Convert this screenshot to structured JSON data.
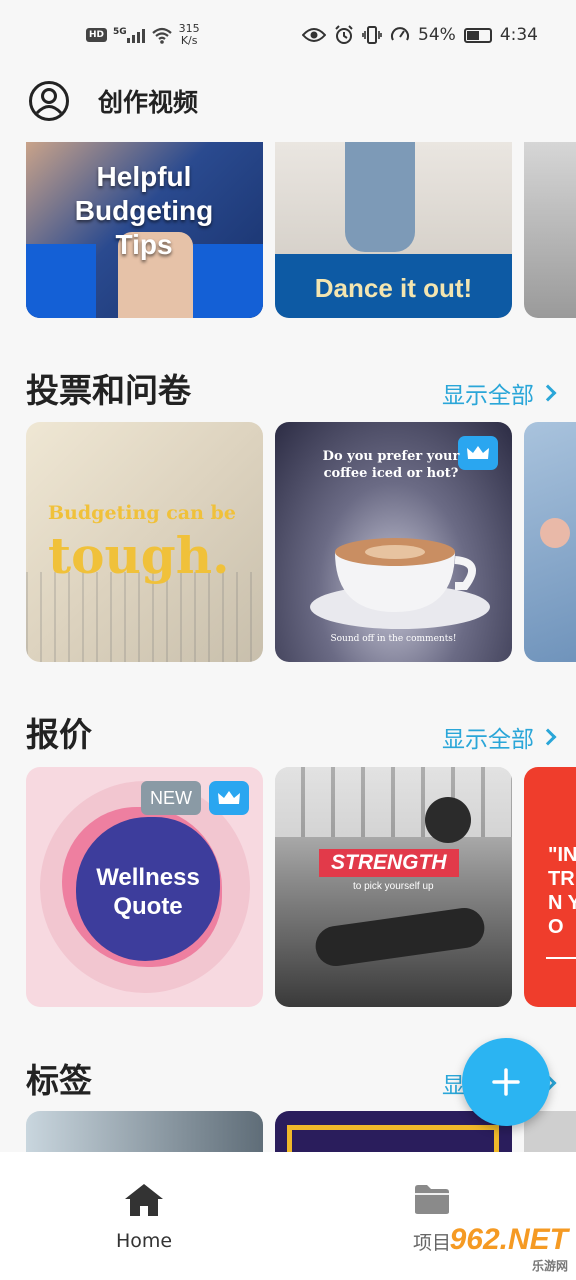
{
  "status_bar": {
    "network_badge": "HD",
    "signal_type": "5G",
    "speed_value": "315",
    "speed_unit": "K/s",
    "battery": "54%",
    "time": "4:34"
  },
  "header": {
    "title": "创作视频"
  },
  "top_row": {
    "cards": [
      {
        "text": "Helpful Budgeting Tips"
      },
      {
        "text": "Dance it out!"
      }
    ]
  },
  "sections": [
    {
      "title": "投票和问卷",
      "show_all": "显示全部",
      "cards": [
        {
          "line1": "Budgeting can be",
          "line2": "tough."
        },
        {
          "question": "Do you prefer your coffee iced or hot?",
          "footer": "Sound off in the comments!"
        }
      ]
    },
    {
      "title": "报价",
      "show_all": "显示全部",
      "cards": [
        {
          "badge": "NEW",
          "text": "Wellness Quote"
        },
        {
          "headline": "STRENGTH",
          "sub": "to pick yourself up"
        },
        {
          "text": "\"IN TR IN YO"
        }
      ]
    },
    {
      "title": "标签",
      "show_all": "显示全部"
    }
  ],
  "bottom_nav": {
    "items": [
      {
        "label": "Home",
        "icon": "home-icon"
      },
      {
        "label": "项目",
        "icon": "folder-icon"
      }
    ]
  },
  "watermark": {
    "main": "962.NET",
    "sub": "乐游网"
  },
  "colors": {
    "accent": "#2aa6d8",
    "fab": "#2bb4f2"
  }
}
